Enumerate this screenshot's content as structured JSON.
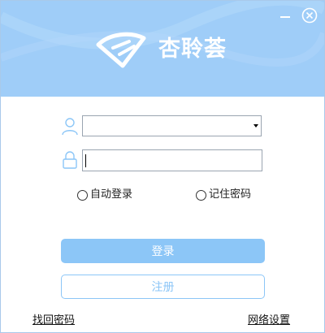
{
  "header": {
    "brand_name": "杏聆荟",
    "minimize_icon": "minimize-icon",
    "close_icon": "close-circle-icon",
    "logo_icon": "wing-logo-icon",
    "background_color": "#9fcdf8"
  },
  "form": {
    "account": {
      "icon": "user-icon",
      "value": "",
      "placeholder": ""
    },
    "password": {
      "icon": "lock-icon",
      "value": "",
      "placeholder": ""
    },
    "options": [
      {
        "label": "自动登录",
        "checked": false
      },
      {
        "label": "记住密码",
        "checked": false
      }
    ],
    "login_label": "登录",
    "register_label": "注册",
    "accent_color": "#8cc6f7"
  },
  "footer": {
    "forgot_password": "找回密码",
    "network_settings": "网络设置"
  }
}
